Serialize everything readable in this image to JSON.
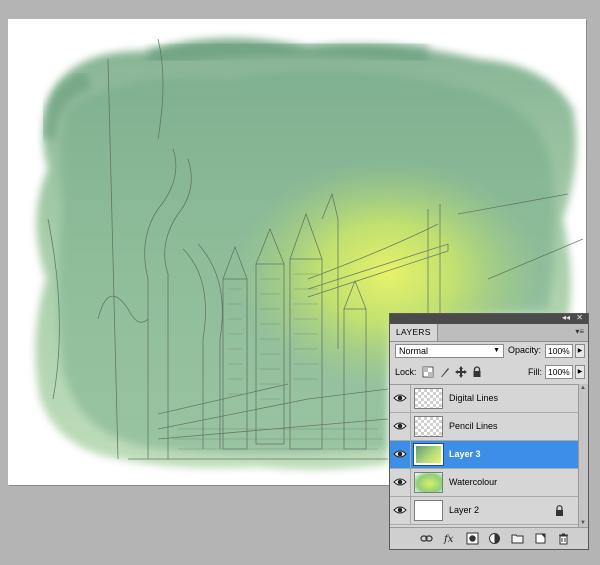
{
  "panel": {
    "tab_label": "LAYERS",
    "blend_mode": "Normal",
    "opacity_label": "Opacity:",
    "opacity_value": "100%",
    "lock_label": "Lock:",
    "fill_label": "Fill:",
    "fill_value": "100%"
  },
  "layers": [
    {
      "name": "Digital Lines",
      "thumbnail": "checker",
      "visible": true,
      "selected": false,
      "locked": false
    },
    {
      "name": "Pencil Lines",
      "thumbnail": "checker",
      "visible": true,
      "selected": false,
      "locked": false
    },
    {
      "name": "Layer 3",
      "thumbnail": "green-wash",
      "visible": true,
      "selected": true,
      "locked": false
    },
    {
      "name": "Watercolour",
      "thumbnail": "watercolour",
      "visible": true,
      "selected": false,
      "locked": false
    },
    {
      "name": "Layer 2",
      "thumbnail": "white",
      "visible": true,
      "selected": false,
      "locked": true
    }
  ],
  "bottom_icons": [
    "link-icon",
    "fx-icon",
    "mask-icon",
    "adjustment-icon",
    "folder-icon",
    "new-layer-icon",
    "trash-icon"
  ],
  "colors": {
    "selection": "#3d8ee6",
    "canvas_bg": "#b4b4b4",
    "panel_bg": "#d6d6d6"
  }
}
